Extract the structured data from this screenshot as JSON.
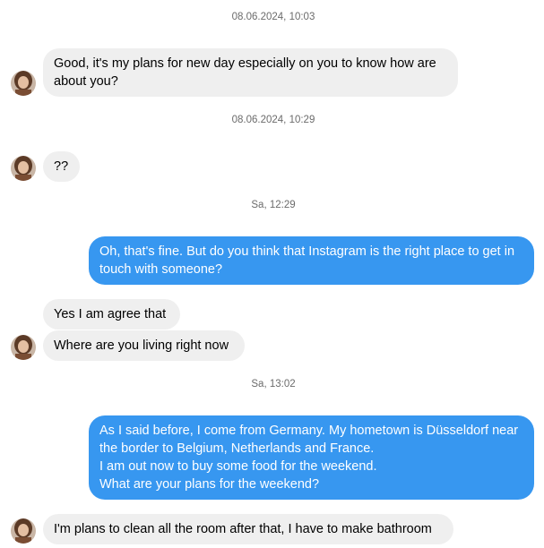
{
  "colors": {
    "outgoing_bubble": "#3797f0",
    "incoming_bubble": "#efefef",
    "timestamp_text": "#6b6b6b"
  },
  "timestamps": [
    "08.06.2024, 10:03",
    "08.06.2024, 10:29",
    "Sa, 12:29",
    "Sa, 13:02"
  ],
  "messages": [
    {
      "direction": "incoming",
      "text": "Good, it's my plans for new day especially on you to know how are about you?"
    },
    {
      "direction": "incoming",
      "text": "??"
    },
    {
      "direction": "outgoing",
      "text": "Oh, that's fine. But do you think that Instagram is the right place to get in touch with someone?"
    },
    {
      "direction": "incoming",
      "text": "Yes I am agree that"
    },
    {
      "direction": "incoming",
      "text": "Where are you living right now"
    },
    {
      "direction": "outgoing",
      "text": "As I said before, I come from Germany. My hometown is Düsseldorf near the border to Belgium, Netherlands and France.\nI am out now to buy some food for the weekend.\nWhat are your plans for the weekend?"
    },
    {
      "direction": "incoming",
      "text": "I'm plans to clean all the room after that, I have to make bathroom"
    }
  ]
}
